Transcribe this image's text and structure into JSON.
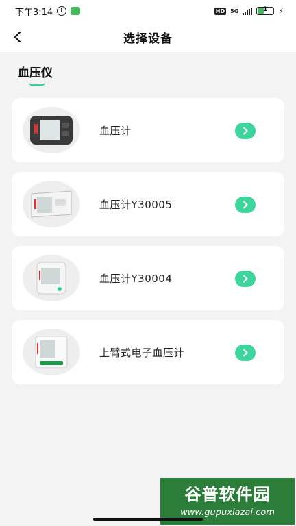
{
  "status_bar": {
    "time": "下午3:14",
    "hd": "HD",
    "network": "5G",
    "battery": "1"
  },
  "header": {
    "title": "选择设备"
  },
  "section": {
    "title": "血压仪"
  },
  "devices": [
    {
      "label": "血压计"
    },
    {
      "label": "血压计Y30005"
    },
    {
      "label": "血压计Y30004"
    },
    {
      "label": "上臂式电子血压计"
    }
  ],
  "watermark": {
    "top": "谷普软件园",
    "bottom": "www.gupuxiazai.com"
  },
  "colors": {
    "accent": "#3ed59c",
    "background": "#f3f3f3",
    "card": "#ffffff"
  }
}
